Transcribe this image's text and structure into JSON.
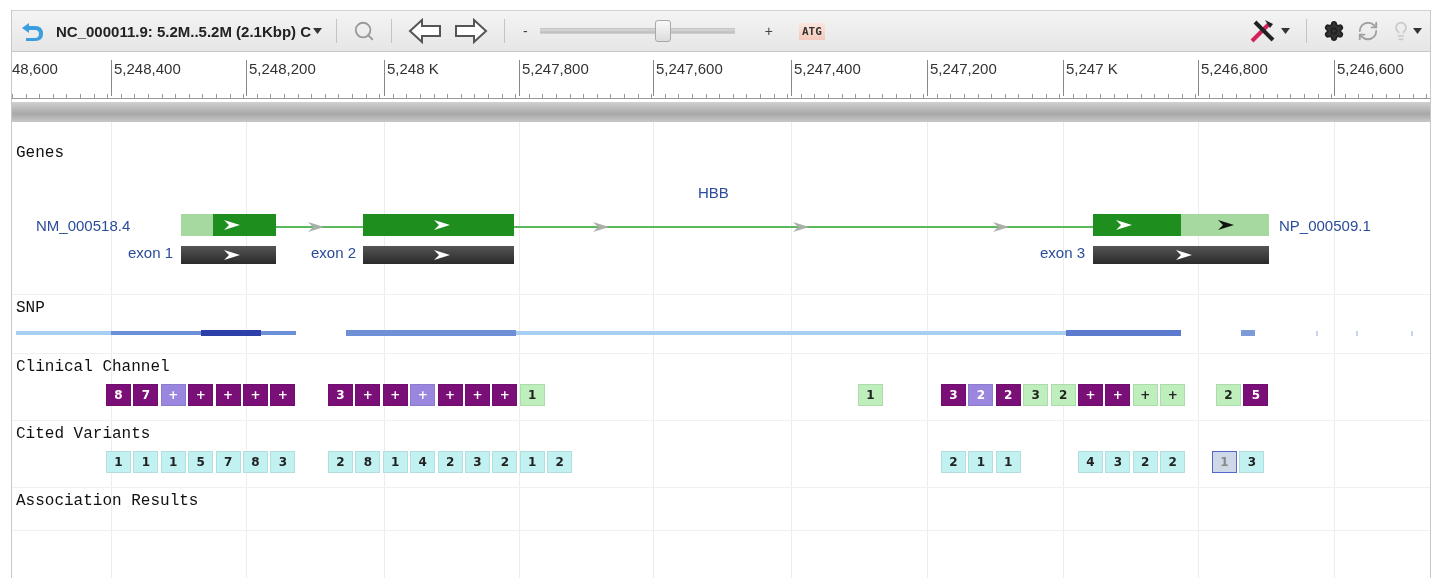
{
  "toolbar": {
    "title": "NC_000011.9: 5.2M..5.2M (2.1Kbp) C",
    "zoom_out": "-",
    "zoom_in": "+",
    "zoom": {
      "level": 0.64
    },
    "sequence_button": "ATG"
  },
  "ruler": {
    "ticks": [
      "48,600",
      "5,248,400",
      "5,248,200",
      "5,248 K",
      "5,247,800",
      "5,247,600",
      "5,247,400",
      "5,247,200",
      "5,247 K",
      "5,246,800",
      "5,246,600"
    ]
  },
  "tracks": [
    {
      "kind": "genes",
      "title": "Genes",
      "gene": {
        "name": "HBB",
        "transcript": "NM_000518.4",
        "protein": "NP_000509.1",
        "exons": [
          "exon 1",
          "exon 2",
          "exon 3"
        ]
      }
    },
    {
      "kind": "snp",
      "title": "SNP"
    },
    {
      "kind": "badges",
      "title": "Clinical Channel",
      "groups": [
        [
          {
            "text": "8",
            "color": "#7a0f78"
          },
          {
            "text": "7",
            "color": "#7a0f78"
          },
          {
            "text": "+",
            "color": "#9a86de"
          },
          {
            "text": "+",
            "color": "#7a0f78"
          },
          {
            "text": "+",
            "color": "#7a0f78"
          },
          {
            "text": "+",
            "color": "#7a0f78"
          },
          {
            "text": "+",
            "color": "#7a0f78"
          }
        ],
        [
          {
            "text": "3",
            "color": "#7a0f78"
          },
          {
            "text": "+",
            "color": "#7a0f78"
          },
          {
            "text": "+",
            "color": "#7a0f78"
          },
          {
            "text": "+",
            "color": "#9a86de"
          },
          {
            "text": "+",
            "color": "#7a0f78"
          },
          {
            "text": "+",
            "color": "#7a0f78"
          },
          {
            "text": "+",
            "color": "#7a0f78"
          },
          {
            "text": "1",
            "color": "#bdeebb"
          }
        ],
        [
          {
            "text": "1",
            "color": "#bdeebb"
          }
        ],
        [
          {
            "text": "3",
            "color": "#7a0f78"
          },
          {
            "text": "2",
            "color": "#9a86de"
          },
          {
            "text": "2",
            "color": "#7a0f78"
          },
          {
            "text": "3",
            "color": "#bdeebb"
          },
          {
            "text": "2",
            "color": "#bdeebb"
          },
          {
            "text": "+",
            "color": "#7a0f78"
          },
          {
            "text": "+",
            "color": "#7a0f78"
          },
          {
            "text": "+",
            "color": "#bdeebb"
          },
          {
            "text": "+",
            "color": "#bdeebb"
          }
        ],
        [
          {
            "text": "2",
            "color": "#bdeebb"
          },
          {
            "text": "5",
            "color": "#7a0f78"
          }
        ]
      ]
    },
    {
      "kind": "badges",
      "title": "Cited Variants",
      "groups": [
        [
          {
            "text": "1",
            "selected": false
          },
          {
            "text": "1",
            "selected": false
          },
          {
            "text": "1",
            "selected": false
          },
          {
            "text": "5",
            "selected": false
          },
          {
            "text": "7",
            "selected": false
          },
          {
            "text": "8",
            "selected": false
          },
          {
            "text": "3",
            "selected": false
          }
        ],
        [
          {
            "text": "2",
            "selected": false
          },
          {
            "text": "8",
            "selected": false
          },
          {
            "text": "1",
            "selected": false
          },
          {
            "text": "4",
            "selected": false
          },
          {
            "text": "2",
            "selected": false
          },
          {
            "text": "3",
            "selected": false
          },
          {
            "text": "2",
            "selected": false
          },
          {
            "text": "1",
            "selected": false
          },
          {
            "text": "2",
            "selected": false
          }
        ],
        [
          {
            "text": "2",
            "selected": false
          },
          {
            "text": "1",
            "selected": false
          },
          {
            "text": "1",
            "selected": false
          }
        ],
        [
          {
            "text": "4",
            "selected": false
          },
          {
            "text": "3",
            "selected": false
          },
          {
            "text": "2",
            "selected": false
          },
          {
            "text": "2",
            "selected": false
          }
        ],
        [
          {
            "text": "1",
            "selected": true
          },
          {
            "text": "3",
            "selected": false
          }
        ]
      ]
    },
    {
      "kind": "empty",
      "title": "Association Results"
    }
  ]
}
